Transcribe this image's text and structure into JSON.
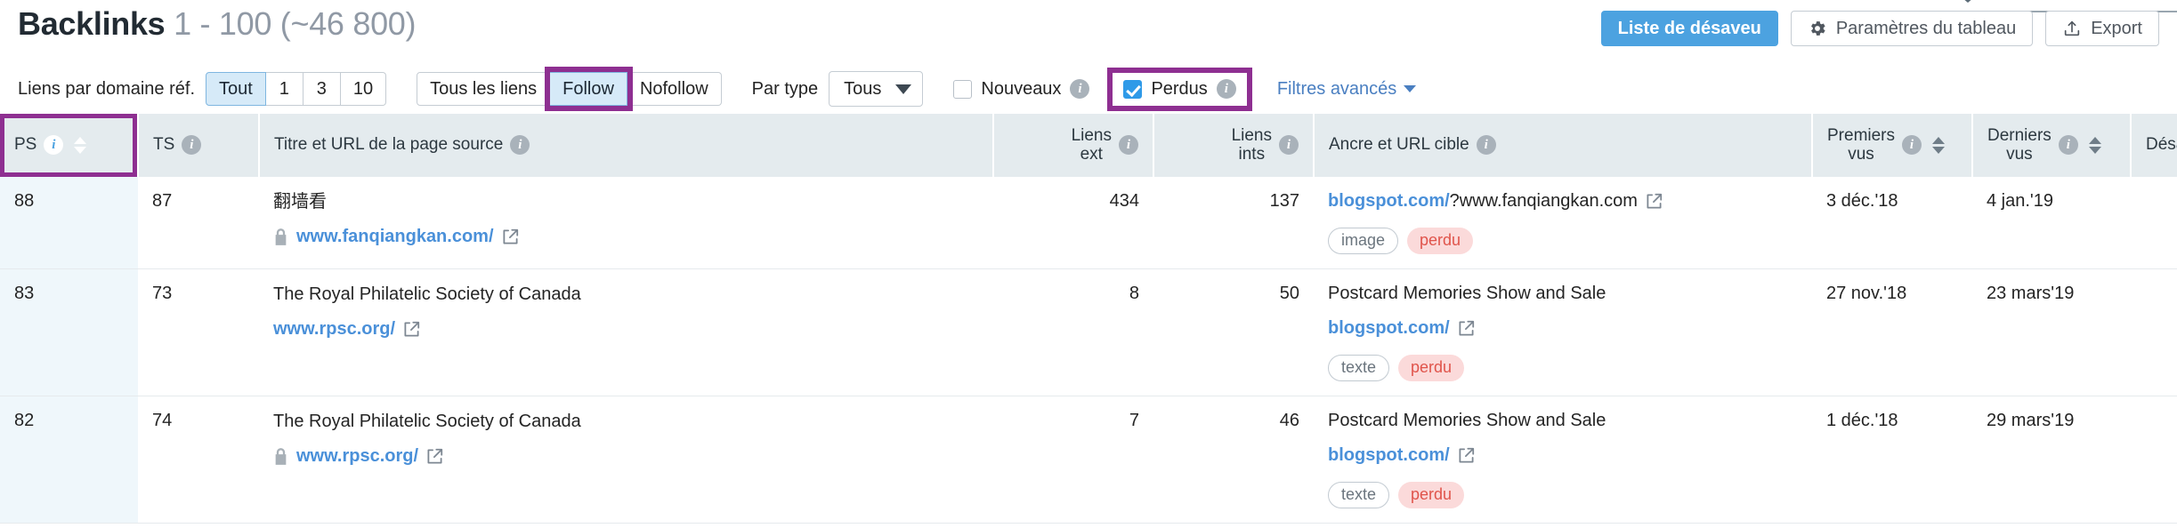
{
  "header": {
    "title": "Backlinks",
    "range": "1 - 100 (~46 800)",
    "disavow_button": "Liste de désaveu",
    "table_settings_button": "Paramètres du tableau",
    "export_button": "Export",
    "gear_icon": "gear-icon",
    "export_icon": "upload-icon",
    "collapse_icon": "caret-down-icon"
  },
  "filters": {
    "links_per_domain_label": "Liens par domaine réf.",
    "links_per_domain_options": [
      "Tout",
      "1",
      "3",
      "10"
    ],
    "links_per_domain_selected": "Tout",
    "follow_options": [
      "Tous les liens",
      "Follow",
      "Nofollow"
    ],
    "follow_selected": "Follow",
    "type_label": "Par type",
    "type_value": "Tous",
    "new_label": "Nouveaux",
    "new_checked": false,
    "lost_label": "Perdus",
    "lost_checked": true,
    "advanced_label": "Filtres avancés",
    "info_icon": "info-icon",
    "chevron_icon": "chevron-down-icon",
    "highlight_color": "#8e2f91"
  },
  "table": {
    "columns": [
      {
        "key": "ps",
        "label": "PS",
        "info": true,
        "sortable": true,
        "align": "left",
        "active": true
      },
      {
        "key": "ts",
        "label": "TS",
        "info": true,
        "sortable": false,
        "align": "left",
        "active": false
      },
      {
        "key": "source",
        "label": "Titre et URL de la page source",
        "info": true,
        "sortable": false,
        "align": "left",
        "active": false
      },
      {
        "key": "ext",
        "label": "Liens ext",
        "info": true,
        "sortable": false,
        "align": "right",
        "active": false
      },
      {
        "key": "int",
        "label": "Liens ints",
        "info": true,
        "sortable": false,
        "align": "right",
        "active": false
      },
      {
        "key": "anchor",
        "label": "Ancre et URL cible",
        "info": true,
        "sortable": false,
        "align": "left",
        "active": false
      },
      {
        "key": "first",
        "label": "Premiers vus",
        "info": true,
        "sortable": true,
        "align": "left",
        "active": false
      },
      {
        "key": "last",
        "label": "Derniers vus",
        "info": true,
        "sortable": true,
        "align": "left",
        "active": false
      },
      {
        "key": "disavow",
        "label": "Désavouer",
        "info": false,
        "sortable": false,
        "align": "left",
        "active": false
      }
    ],
    "rows": [
      {
        "ps": "88",
        "ts": "87",
        "source_title": "翻墙看",
        "source_url": "www.fanqiangkan.com/",
        "source_lock": true,
        "links_ext": "434",
        "links_int": "137",
        "anchor_text": "blogspot.com/",
        "anchor_rest": "?www.fanqiangkan.com",
        "anchor_is_link": true,
        "target_url": "",
        "target_lock": false,
        "tags": [
          "image",
          "perdu"
        ],
        "first_seen": "3 déc.'18",
        "last_seen": "4 jan.'19",
        "disavow_icon": "plus-icon"
      },
      {
        "ps": "83",
        "ts": "73",
        "source_title": "The Royal Philatelic Society of Canada",
        "source_url": "www.rpsc.org/",
        "source_lock": false,
        "links_ext": "8",
        "links_int": "50",
        "anchor_text": "Postcard Memories Show and Sale",
        "anchor_rest": "",
        "anchor_is_link": false,
        "target_url": "blogspot.com/",
        "target_lock": false,
        "tags": [
          "texte",
          "perdu"
        ],
        "first_seen": "27 nov.'18",
        "last_seen": "23 mars'19",
        "disavow_icon": "plus-icon"
      },
      {
        "ps": "82",
        "ts": "74",
        "source_title": "The Royal Philatelic Society of Canada",
        "source_url": "www.rpsc.org/",
        "source_lock": true,
        "links_ext": "7",
        "links_int": "46",
        "anchor_text": "Postcard Memories Show and Sale",
        "anchor_rest": "",
        "anchor_is_link": false,
        "target_url": "blogspot.com/",
        "target_lock": false,
        "tags": [
          "texte",
          "perdu"
        ],
        "first_seen": "1 déc.'18",
        "last_seen": "29 mars'19",
        "disavow_icon": "plus-icon"
      }
    ]
  },
  "colors": {
    "accent_blue": "#4ca2e0",
    "link_blue": "#4a90d9",
    "lost_red": "#e0544b",
    "header_bg": "#e4ebee",
    "highlight_purple": "#8e2f91"
  }
}
